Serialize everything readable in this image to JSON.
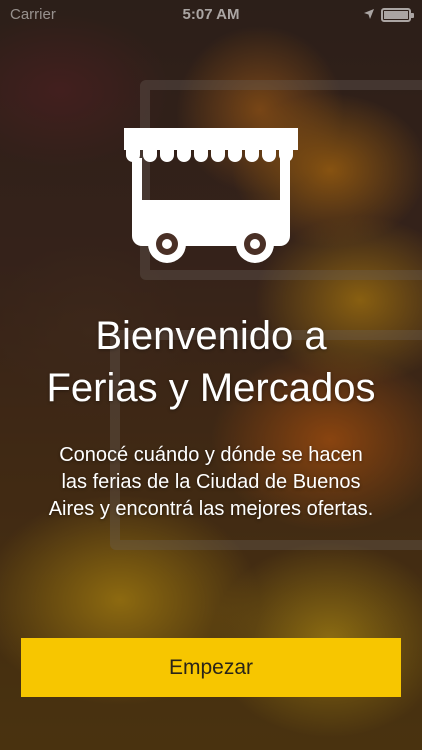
{
  "status_bar": {
    "carrier": "Carrier",
    "time": "5:07 AM",
    "location_icon": "location-arrow-icon",
    "battery_icon": "battery-icon"
  },
  "hero": {
    "icon": "market-stall-cart-icon",
    "title_line1": "Bienvenido a",
    "title_line2": "Ferias y Mercados",
    "subtitle_line1": "Conocé cuándo y dónde se hacen",
    "subtitle_line2": "las ferias de la Ciudad de Buenos",
    "subtitle_line3": "Aires y encontrá las mejores ofertas."
  },
  "actions": {
    "start_label": "Empezar"
  },
  "colors": {
    "accent": "#f7c600",
    "text": "#ffffff",
    "button_text": "#2a2418"
  }
}
